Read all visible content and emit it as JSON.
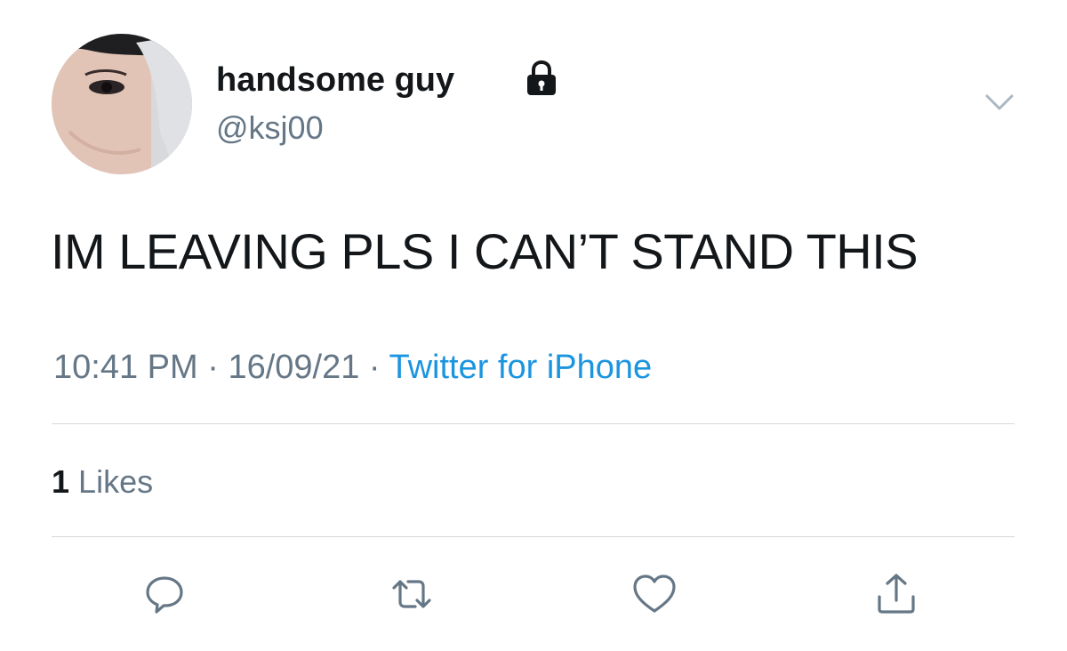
{
  "tweet": {
    "author": {
      "display_name": "handsome guy",
      "handle": "@ksj00",
      "protected_icon": "lock-icon",
      "avatar": "profile-photo"
    },
    "menu_icon": "chevron-down-icon",
    "text": "IM LEAVING PLS I CAN’T STAND THIS",
    "time": "10:41 PM",
    "date": "16/09/21",
    "separator": "·",
    "source": "Twitter for iPhone",
    "likes": {
      "count": "1",
      "label": "Likes"
    },
    "actions": [
      {
        "icon": "reply-icon"
      },
      {
        "icon": "retweet-icon"
      },
      {
        "icon": "heart-icon"
      },
      {
        "icon": "share-icon"
      }
    ],
    "colors": {
      "text": "#14171a",
      "secondary": "#657786",
      "link": "#1b95e0",
      "divider": "#d4d8dc"
    }
  }
}
